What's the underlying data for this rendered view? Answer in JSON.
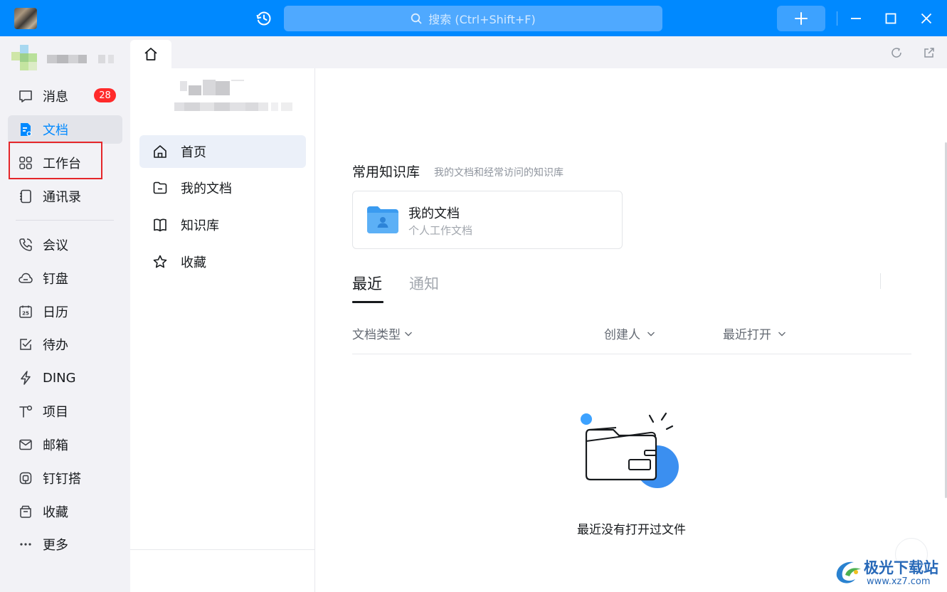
{
  "topbar": {
    "search_placeholder": "搜索 (Ctrl+Shift+F)",
    "accent_color": "#0089ff"
  },
  "nav": {
    "items": [
      {
        "label": "消息",
        "icon": "message-icon",
        "badge": "28"
      },
      {
        "label": "文档",
        "icon": "doc-icon",
        "active": true
      },
      {
        "label": "工作台",
        "icon": "grid-icon"
      },
      {
        "label": "通讯录",
        "icon": "contacts-icon"
      },
      {
        "label": "会议",
        "icon": "phone-icon"
      },
      {
        "label": "钉盘",
        "icon": "cloud-icon"
      },
      {
        "label": "日历",
        "icon": "calendar-icon"
      },
      {
        "label": "待办",
        "icon": "todo-icon"
      },
      {
        "label": "DING",
        "icon": "lightning-icon"
      },
      {
        "label": "项目",
        "icon": "project-icon"
      },
      {
        "label": "邮箱",
        "icon": "mail-icon"
      },
      {
        "label": "钉钉搭",
        "icon": "builder-icon"
      },
      {
        "label": "收藏",
        "icon": "favorites-icon"
      },
      {
        "label": "更多",
        "icon": "more-icon"
      }
    ]
  },
  "doc_sidebar": {
    "items": [
      {
        "label": "首页",
        "icon": "home-icon",
        "active": true
      },
      {
        "label": "我的文档",
        "icon": "folder-icon"
      },
      {
        "label": "知识库",
        "icon": "book-icon"
      },
      {
        "label": "收藏",
        "icon": "star-icon"
      }
    ]
  },
  "main": {
    "section_title": "常用知识库",
    "section_subtitle": "我的文档和经常访问的知识库",
    "card": {
      "title": "我的文档",
      "subtitle": "个人工作文档"
    },
    "tabs": {
      "recent": "最近",
      "notify": "通知"
    },
    "filters": {
      "doc_type": "文档类型",
      "creator": "创建人",
      "recent_open": "最近打开"
    },
    "empty_text": "最近没有打开过文件"
  },
  "watermark": {
    "name": "极光下载站",
    "url": "www.xz7.com"
  }
}
